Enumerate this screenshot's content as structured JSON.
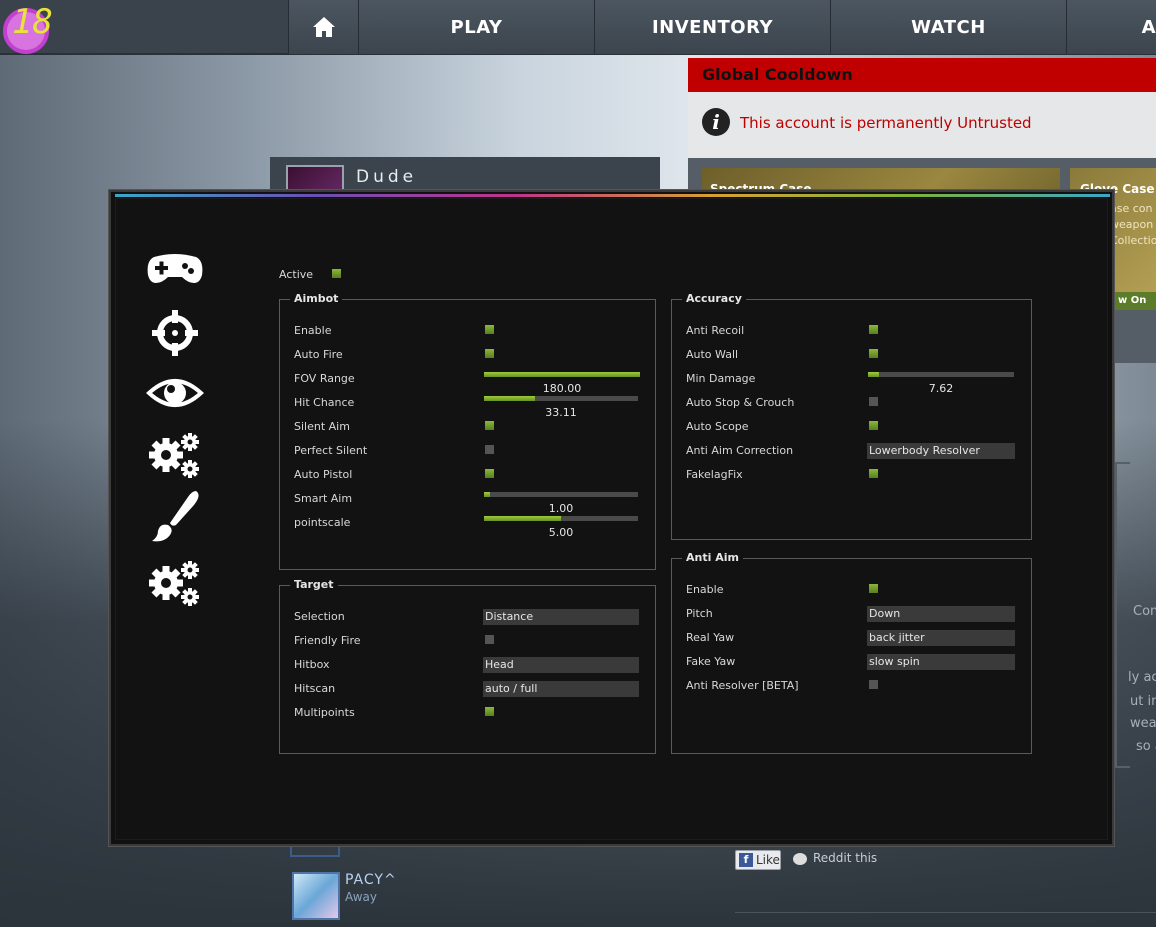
{
  "colors": {
    "accent_green": "#7fae2c",
    "cooldown_red": "#c00000",
    "menu_bg": "#121212"
  },
  "game_ui": {
    "level": "18",
    "nav": {
      "home_icon": "home-icon",
      "play": "PLAY",
      "inventory": "INVENTORY",
      "watch": "WATCH",
      "more": "A"
    },
    "cooldown": {
      "title": "Global Cooldown",
      "icon": "info-icon",
      "message": "This account is permanently Untrusted"
    },
    "friend": {
      "name": "Dude"
    },
    "cases": {
      "case1": "Spectrum Case",
      "case2": "Glove Case",
      "case2_desc_1": "ase con",
      "case2_desc_2": "weapon",
      "case2_desc_3": "Collection",
      "view_button": "w On Ma"
    },
    "side_text": [
      "Con",
      "ly ac",
      "ut in",
      "wea",
      "so a"
    ],
    "friend2": {
      "name": "PACY^",
      "status": "Away"
    },
    "share": {
      "like": "Like",
      "reddit": "Reddit this"
    }
  },
  "menu": {
    "tabs": [
      {
        "name": "gamepad-icon",
        "label": "legit"
      },
      {
        "name": "crosshair-icon",
        "label": "aimbot"
      },
      {
        "name": "eye-icon",
        "label": "visuals"
      },
      {
        "name": "gears-icon",
        "label": "misc"
      },
      {
        "name": "paintbrush-icon",
        "label": "skins"
      },
      {
        "name": "gears-icon",
        "label": "settings"
      }
    ],
    "active_label": "Active",
    "active_on": true,
    "aimbot": {
      "title": "Aimbot",
      "enable": "Enable",
      "enable_on": true,
      "auto_fire": "Auto Fire",
      "auto_fire_on": true,
      "fov_range": "FOV Range",
      "fov_value": "180.00",
      "fov_fraction": 1.0,
      "hit_chance": "Hit Chance",
      "hit_value": "33.11",
      "hit_fraction": 0.3311,
      "silent_aim": "Silent Aim",
      "silent_on": true,
      "perfect_silent": "Perfect Silent",
      "perfect_on": false,
      "auto_pistol": "Auto Pistol",
      "pistol_on": true,
      "smart_aim": "Smart Aim",
      "smart_value": "1.00",
      "smart_fraction": 0.04,
      "pointscale": "pointscale",
      "pointscale_value": "5.00",
      "pointscale_fraction": 0.5
    },
    "target": {
      "title": "Target",
      "selection": "Selection",
      "selection_value": "Distance",
      "friendly_fire": "Friendly Fire",
      "ff_on": false,
      "hitbox": "Hitbox",
      "hitbox_value": "Head",
      "hitscan": "Hitscan",
      "hitscan_value": "auto / full",
      "multipoints": "Multipoints",
      "multipoints_on": true
    },
    "accuracy": {
      "title": "Accuracy",
      "anti_recoil": "Anti Recoil",
      "anti_recoil_on": true,
      "auto_wall": "Auto Wall",
      "auto_wall_on": true,
      "min_damage": "Min Damage",
      "min_damage_value": "7.62",
      "min_damage_fraction": 0.0762,
      "auto_stop": "Auto Stop & Crouch",
      "auto_stop_on": false,
      "auto_scope": "Auto Scope",
      "auto_scope_on": true,
      "aa_correction": "Anti Aim Correction",
      "aa_correction_value": "Lowerbody Resolver",
      "fakelagfix": "FakelagFix",
      "fakelagfix_on": true
    },
    "anti_aim": {
      "title": "Anti Aim",
      "enable": "Enable",
      "enable_on": true,
      "pitch": "Pitch",
      "pitch_value": "Down",
      "real_yaw": "Real Yaw",
      "real_yaw_value": "back jitter",
      "fake_yaw": "Fake Yaw",
      "fake_yaw_value": "slow spin",
      "anti_resolver": "Anti Resolver [BETA]",
      "anti_resolver_on": false
    }
  }
}
